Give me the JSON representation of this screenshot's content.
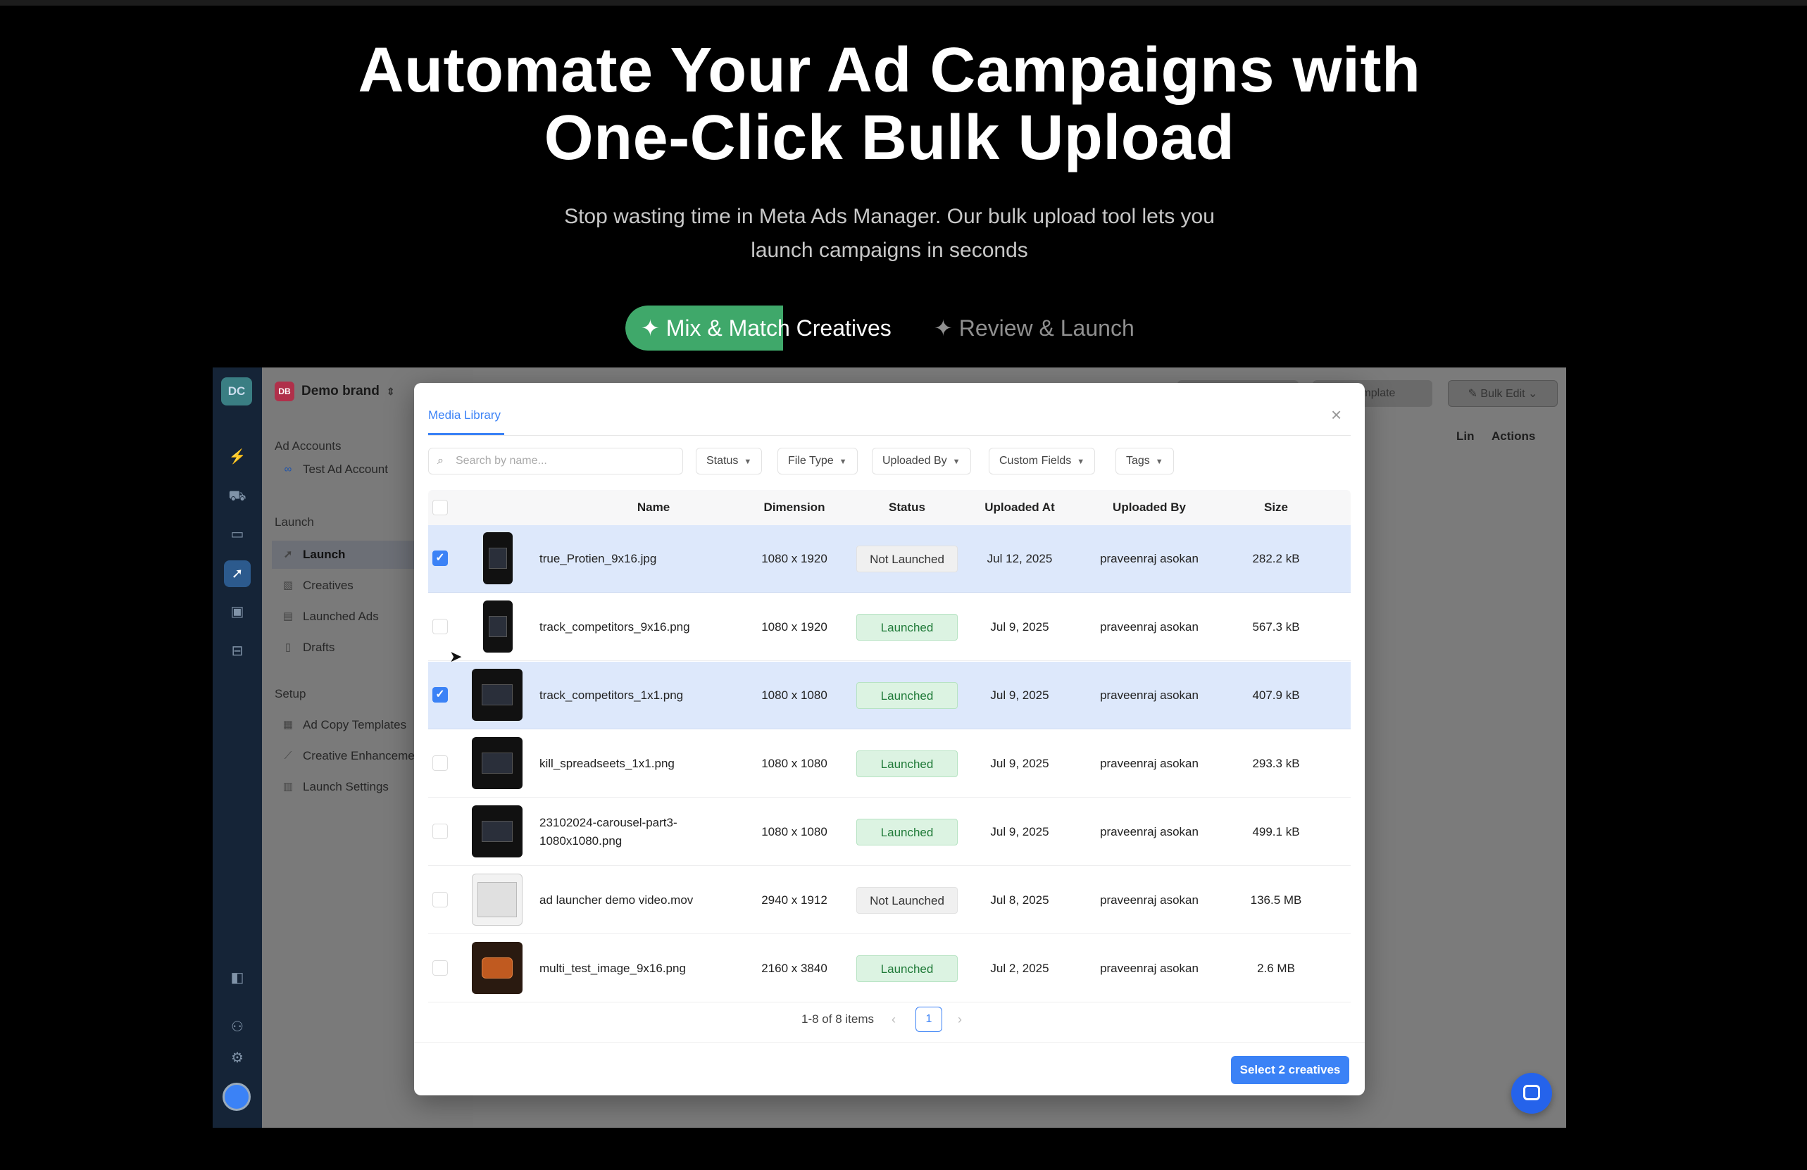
{
  "hero": {
    "title_line1": "Automate Your Ad Campaigns with",
    "title_line2": "One-Click Bulk Upload",
    "subtitle_line1": "Stop wasting time in Meta Ads Manager. Our bulk upload tool lets you",
    "subtitle_line2": "launch campaigns in seconds"
  },
  "tabs": [
    {
      "label": "✦ Mix & Match Creatives",
      "active": true
    },
    {
      "label": "✦ Review & Launch",
      "active": false
    }
  ],
  "colors": {
    "accent_green": "#3fa86a",
    "primary_blue": "#3b82f6",
    "launched_green": "#1f7a38"
  },
  "app": {
    "rail_logo": "DC",
    "brand_badge": "DB",
    "brand_name": "Demo brand",
    "sections": {
      "ad_accounts": "Ad Accounts",
      "account_name": "Test Ad Account",
      "launch": "Launch",
      "setup": "Setup"
    },
    "launch_items": [
      {
        "label": "Launch",
        "icon": "rocket-icon",
        "active": true
      },
      {
        "label": "Creatives",
        "icon": "image-icon",
        "active": false
      },
      {
        "label": "Launched Ads",
        "icon": "list-icon",
        "active": false
      },
      {
        "label": "Drafts",
        "icon": "file-icon",
        "active": false
      }
    ],
    "setup_items": [
      {
        "label": "Ad Copy Templates",
        "icon": "template-icon"
      },
      {
        "label": "Creative Enhancemen",
        "icon": "wand-icon"
      },
      {
        "label": "Launch Settings",
        "icon": "settings-icon"
      }
    ],
    "behind": {
      "template_btn": "Template",
      "bulk_edit_btn": "Bulk Edit",
      "col_lin": "Lin",
      "col_actions": "Actions"
    }
  },
  "modal": {
    "tab": "Media Library",
    "search_placeholder": "Search by name...",
    "filters": [
      "Status",
      "File Type",
      "Uploaded By",
      "Custom Fields",
      "Tags"
    ],
    "columns": [
      "Name",
      "Dimension",
      "Status",
      "Uploaded At",
      "Uploaded By",
      "Size"
    ],
    "rows": [
      {
        "name": "true_Protien_9x16.jpg",
        "dimension": "1080 x 1920",
        "status": "Not Launched",
        "uploaded_at": "Jul 12, 2025",
        "uploaded_by": "praveenraj asokan",
        "size": "282.2 kB",
        "selected": true
      },
      {
        "name": "track_competitors_9x16.png",
        "dimension": "1080 x 1920",
        "status": "Launched",
        "uploaded_at": "Jul 9, 2025",
        "uploaded_by": "praveenraj asokan",
        "size": "567.3 kB",
        "selected": false
      },
      {
        "name": "track_competitors_1x1.png",
        "dimension": "1080 x 1080",
        "status": "Launched",
        "uploaded_at": "Jul 9, 2025",
        "uploaded_by": "praveenraj asokan",
        "size": "407.9 kB",
        "selected": true
      },
      {
        "name": "kill_spreadseets_1x1.png",
        "dimension": "1080 x 1080",
        "status": "Launched",
        "uploaded_at": "Jul 9, 2025",
        "uploaded_by": "praveenraj asokan",
        "size": "293.3 kB",
        "selected": false
      },
      {
        "name": "23102024-carousel-part3-1080x1080.png",
        "dimension": "1080 x 1080",
        "status": "Launched",
        "uploaded_at": "Jul 9, 2025",
        "uploaded_by": "praveenraj asokan",
        "size": "499.1 kB",
        "selected": false
      },
      {
        "name": "ad launcher demo video.mov",
        "dimension": "2940 x 1912",
        "status": "Not Launched",
        "uploaded_at": "Jul 8, 2025",
        "uploaded_by": "praveenraj asokan",
        "size": "136.5 MB",
        "selected": false
      },
      {
        "name": "multi_test_image_9x16.png",
        "dimension": "2160 x 3840",
        "status": "Launched",
        "uploaded_at": "Jul 2, 2025",
        "uploaded_by": "praveenraj asokan",
        "size": "2.6 MB",
        "selected": false
      }
    ],
    "pagination": {
      "info": "1-8 of 8 items",
      "current_page": "1",
      "prev": "‹",
      "next": "›"
    },
    "select_button": "Select 2 creatives"
  }
}
